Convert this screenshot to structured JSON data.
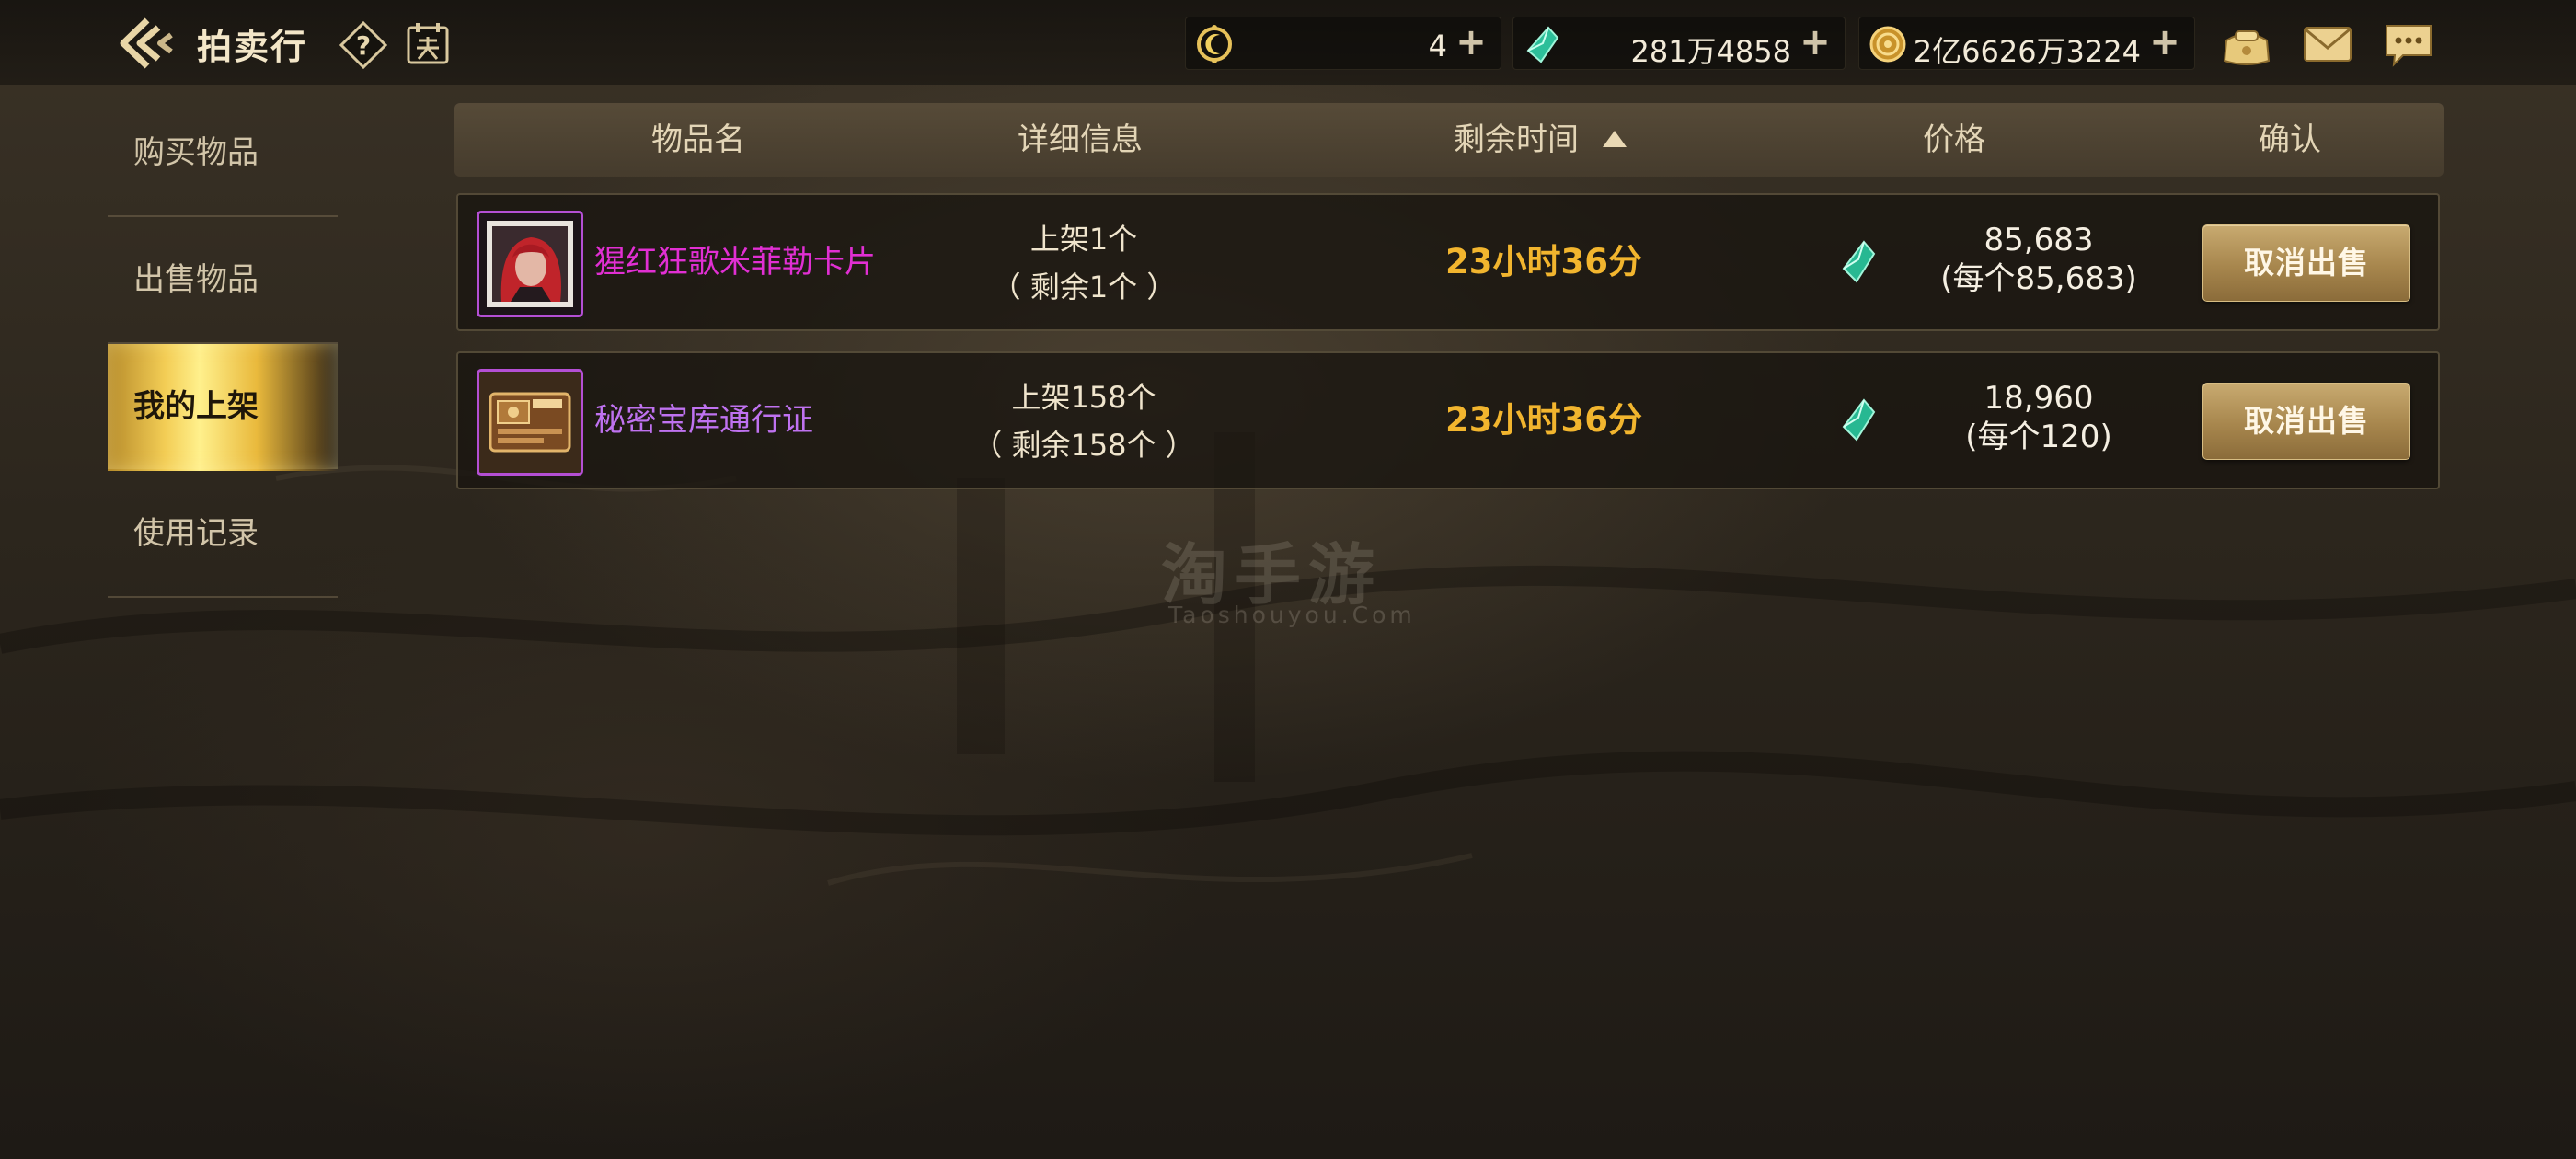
{
  "header": {
    "title": "拍卖行",
    "currencies": [
      {
        "icon": "crescent-token-icon",
        "value": "4"
      },
      {
        "icon": "green-gem-icon",
        "value": "281万4858"
      },
      {
        "icon": "gold-coin-icon",
        "value": "2亿6626万3224"
      }
    ]
  },
  "sidebar": {
    "items": [
      {
        "label": "购买物品"
      },
      {
        "label": "出售物品"
      },
      {
        "label": "我的上架",
        "active": true
      },
      {
        "label": "使用记录"
      }
    ]
  },
  "table": {
    "columns": [
      "物品名",
      "详细信息",
      "剩余时间",
      "价格",
      "确认"
    ],
    "sort_column": "剩余时间",
    "rows": [
      {
        "name": "猩红狂歌米菲勒卡片",
        "name_color": "#e12fd3",
        "detail_line1": "上架1个",
        "detail_line2": "（ 剩余1个 ）",
        "time": "23小时36分",
        "price": "85,683",
        "unit_price": "(每个85,683)",
        "button": "取消出售"
      },
      {
        "name": "秘密宝库通行证",
        "name_color": "#bf72f0",
        "detail_line1": "上架158个",
        "detail_line2": "（ 剩余158个 ）",
        "time": "23小时36分",
        "price": "18,960",
        "unit_price": "(每个120)",
        "button": "取消出售"
      }
    ]
  },
  "watermark": {
    "cn": "淘手游",
    "en": "Taoshouyou.Com"
  }
}
